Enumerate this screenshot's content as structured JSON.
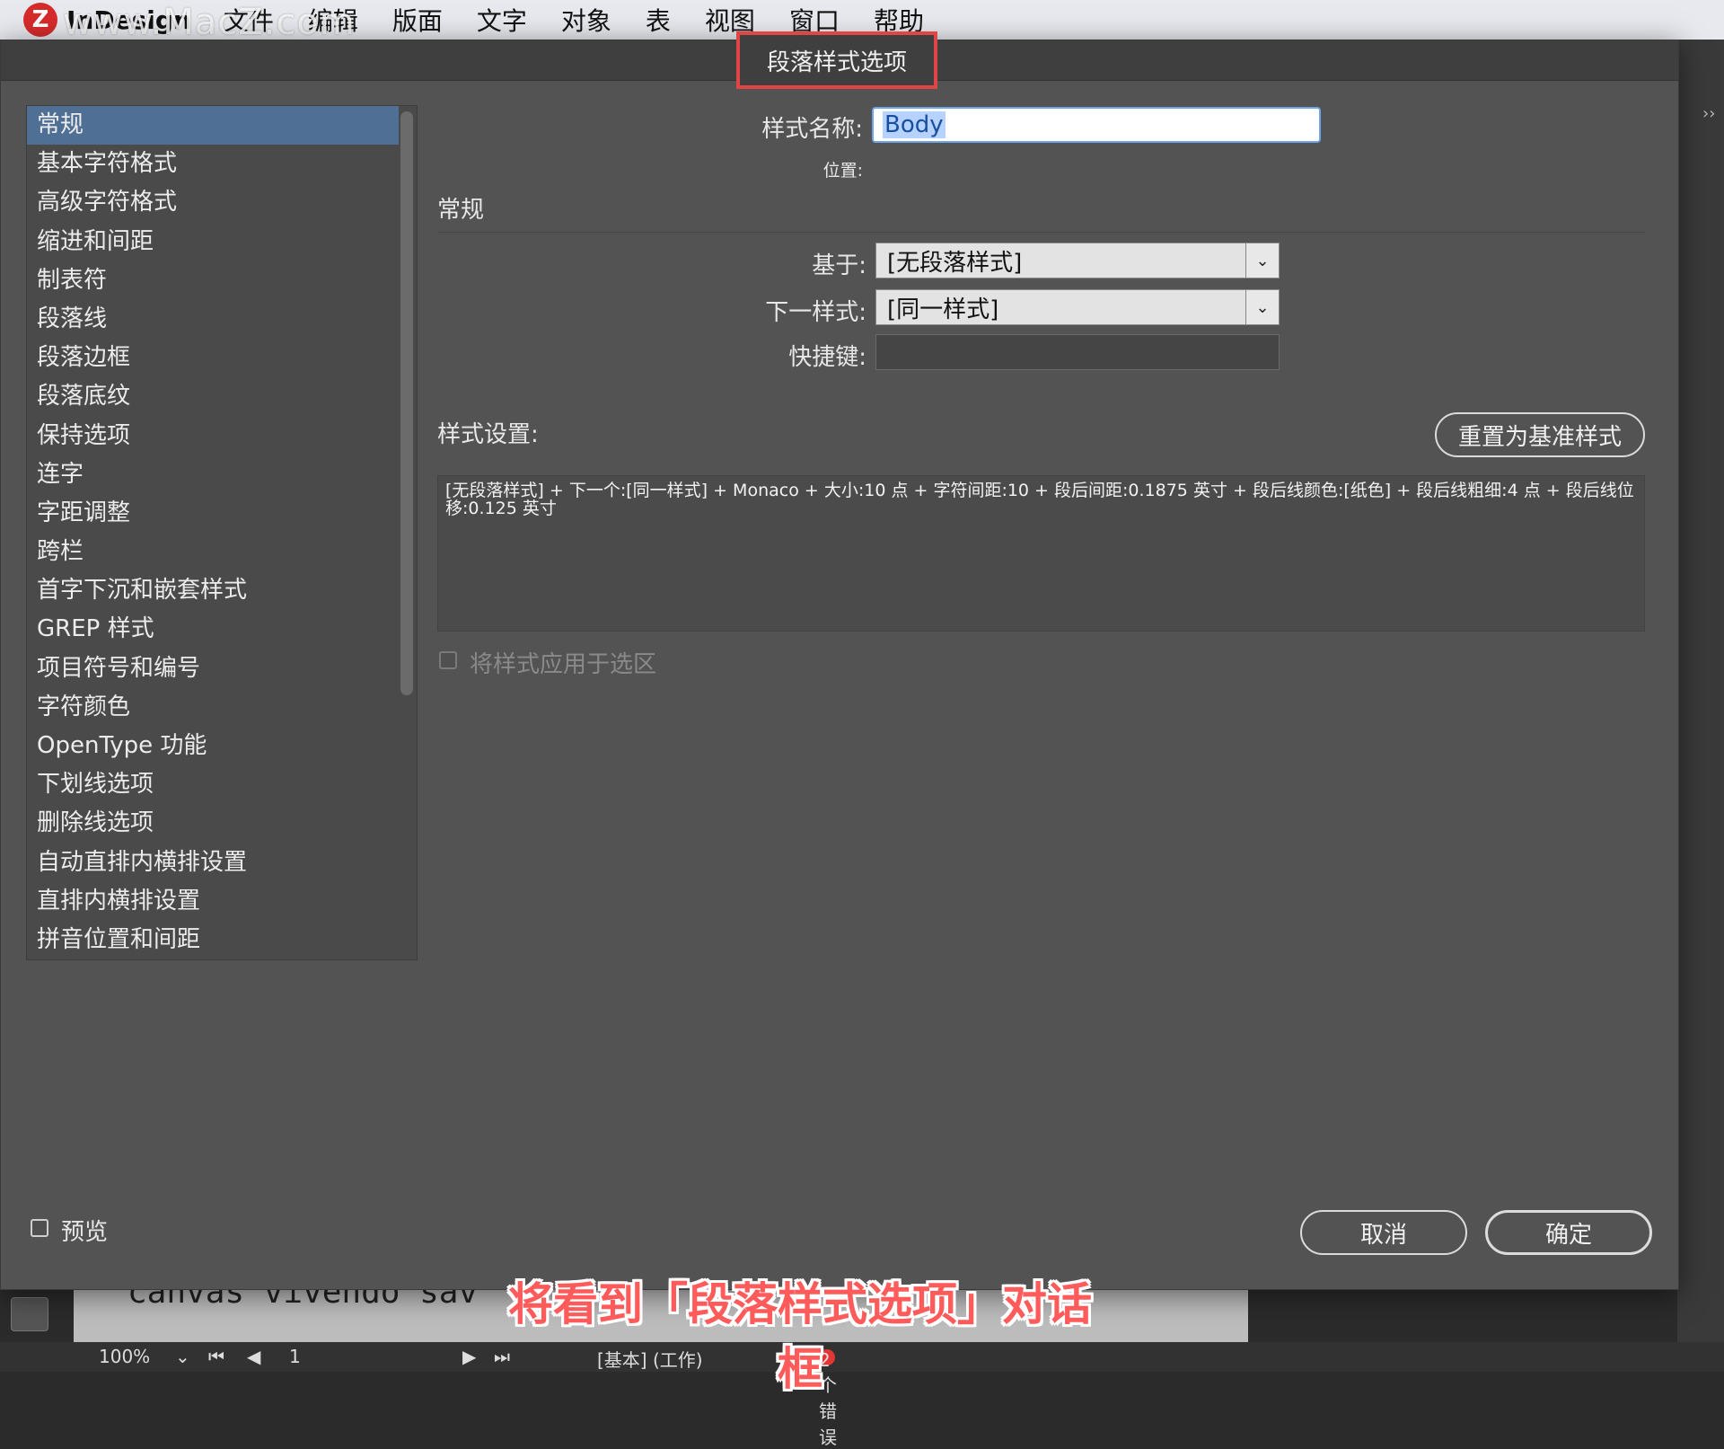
{
  "menubar": {
    "app_name": "InDesign",
    "items": [
      "文件",
      "编辑",
      "版面",
      "文字",
      "对象",
      "表",
      "视图",
      "窗口",
      "帮助"
    ],
    "watermark": "www.MacZ.com"
  },
  "dialog": {
    "title": "段落样式选项",
    "sidebar_items": [
      "常规",
      "基本字符格式",
      "高级字符格式",
      "缩进和间距",
      "制表符",
      "段落线",
      "段落边框",
      "段落底纹",
      "保持选项",
      "连字",
      "字距调整",
      "跨栏",
      "首字下沉和嵌套样式",
      "GREP 样式",
      "项目符号和编号",
      "字符颜色",
      "OpenType 功能",
      "下划线选项",
      "删除线选项",
      "自动直排内横排设置",
      "直排内横排设置",
      "拼音位置和间距"
    ],
    "style_name_label": "样式名称:",
    "style_name_value": "Body",
    "location_label": "位置:",
    "section_title": "常规",
    "based_on_label": "基于:",
    "based_on_value": "[无段落样式]",
    "next_style_label": "下一样式:",
    "next_style_value": "[同一样式]",
    "shortcut_label": "快捷键:",
    "shortcut_value": "",
    "style_settings_label": "样式设置:",
    "reset_button": "重置为基准样式",
    "style_settings_text": "[无段落样式] + 下一个:[同一样式] + Monaco + 大小:10 点 + 字符间距:10 + 段后间距:0.1875 英寸 + 段后线颜色:[纸色] + 段后线粗细:4 点 + 段后线位移:0.125 英寸",
    "apply_checkbox_label": "将样式应用于选区",
    "preview_label": "预览",
    "cancel_button": "取消",
    "ok_button": "确定"
  },
  "statusbar": {
    "zoom": "100%",
    "page": "1",
    "profile": "[基本] (工作)",
    "errors": "2 个错误"
  },
  "caption": "将看到「段落样式选项」对话框",
  "colors": {
    "dialog_bg": "#535353",
    "selected_item": "#4f6f95",
    "highlight_border": "#e04646",
    "caption": "#ff5b5b"
  }
}
